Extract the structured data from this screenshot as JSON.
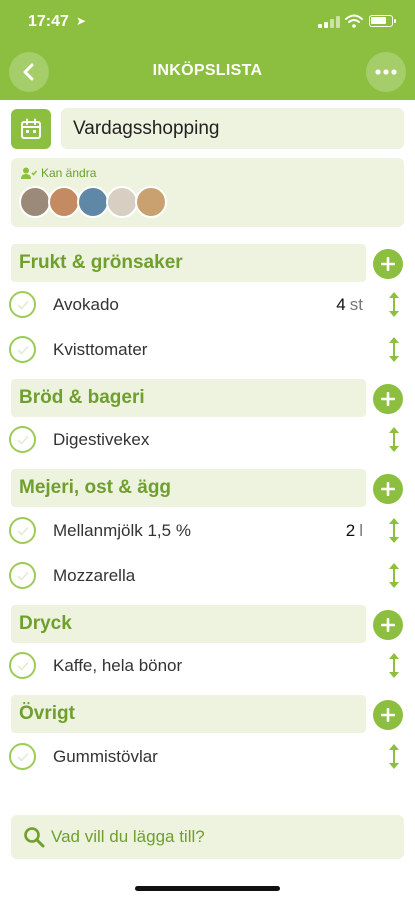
{
  "status_bar": {
    "time": "17:47",
    "location_arrow": "➤"
  },
  "header": {
    "title": "INKÖPSLISTA",
    "back_icon": "chevron-left-icon",
    "more_icon": "more-dots-icon"
  },
  "list": {
    "name": "Vardagsshopping",
    "calendar_icon": "calendar-icon"
  },
  "sharing": {
    "label": "Kan ändra",
    "avatars": [
      {
        "color": "#9b8a78"
      },
      {
        "color": "#c48a62"
      },
      {
        "color": "#5f87a6"
      },
      {
        "color": "#d8cfc2"
      },
      {
        "color": "#c9a070"
      }
    ]
  },
  "categories": [
    {
      "title": "Frukt & grönsaker",
      "items": [
        {
          "name": "Avokado",
          "qty": "4",
          "unit": "st"
        },
        {
          "name": "Kvisttomater",
          "qty": "",
          "unit": ""
        }
      ]
    },
    {
      "title": "Bröd & bageri",
      "items": [
        {
          "name": "Digestivekex",
          "qty": "",
          "unit": ""
        }
      ]
    },
    {
      "title": "Mejeri, ost & ägg",
      "items": [
        {
          "name": "Mellanmjölk 1,5 %",
          "qty": "2",
          "unit": "l"
        },
        {
          "name": "Mozzarella",
          "qty": "",
          "unit": ""
        }
      ]
    },
    {
      "title": "Dryck",
      "items": [
        {
          "name": "Kaffe, hela bönor",
          "qty": "",
          "unit": ""
        }
      ]
    },
    {
      "title": "Övrigt",
      "items": [
        {
          "name": "Gummistövlar",
          "qty": "",
          "unit": ""
        }
      ]
    }
  ],
  "search": {
    "placeholder": "Vad vill du lägga till?"
  },
  "colors": {
    "brand": "#8cbf3f",
    "tint": "#eef3e0",
    "category_text": "#6f9f2d"
  }
}
